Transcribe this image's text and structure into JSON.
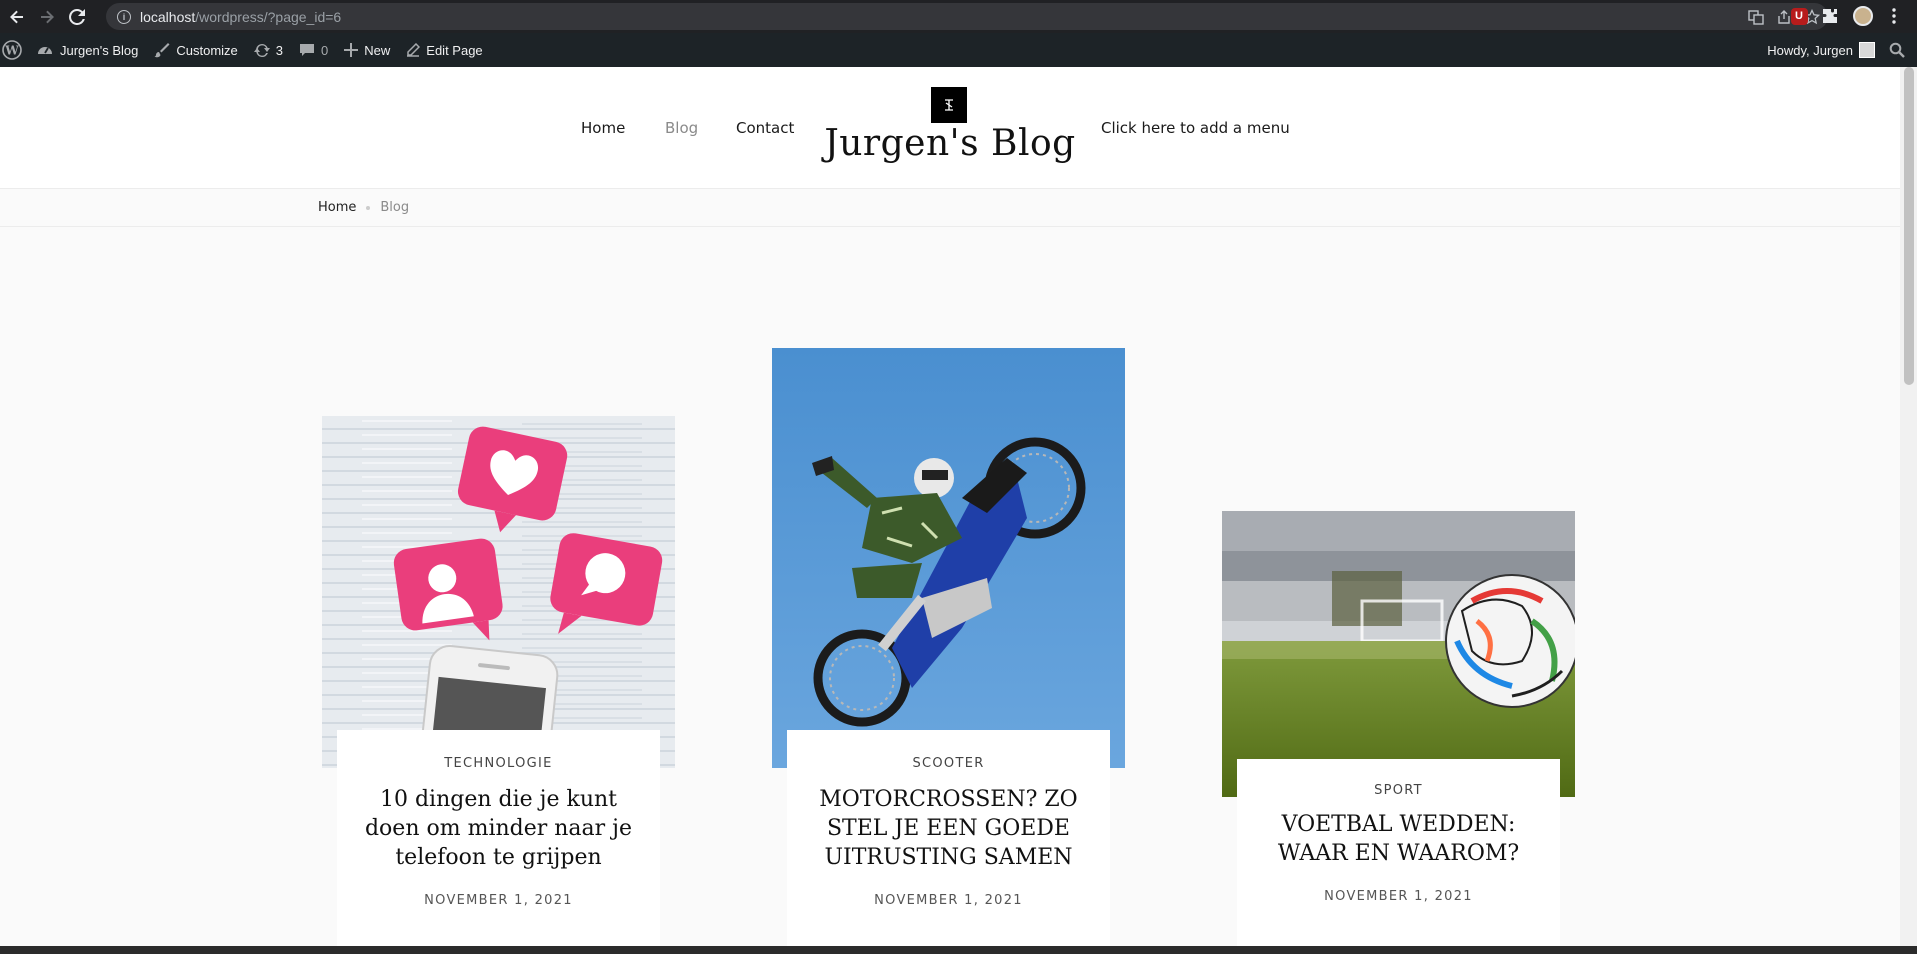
{
  "browser": {
    "url_host": "localhost",
    "url_path": "/wordpress/?page_id=6"
  },
  "adminbar": {
    "site_name": "Jurgen's Blog",
    "customize": "Customize",
    "updates_count": "3",
    "comments_count": "0",
    "new_label": "New",
    "edit_page": "Edit Page",
    "howdy": "Howdy, Jurgen"
  },
  "header": {
    "menu": [
      "Home",
      "Blog",
      "Contact"
    ],
    "site_title": "Jurgen's Blog",
    "add_menu": "Click here to add a menu"
  },
  "breadcrumb": {
    "home": "Home",
    "current": "Blog"
  },
  "posts": [
    {
      "category": "TECHNOLOGIE",
      "title": "10 dingen die je kunt doen om minder naar je telefoon te grijpen",
      "date": "NOVEMBER 1, 2021"
    },
    {
      "category": "SCOOTER",
      "title": "MOTORCROSSEN? ZO STEL JE EEN GOEDE UITRUSTING SAMEN",
      "date": "NOVEMBER 1, 2021"
    },
    {
      "category": "SPORT",
      "title": "VOETBAL WEDDEN: WAAR EN WAAROM?",
      "date": "NOVEMBER 1, 2021"
    }
  ]
}
